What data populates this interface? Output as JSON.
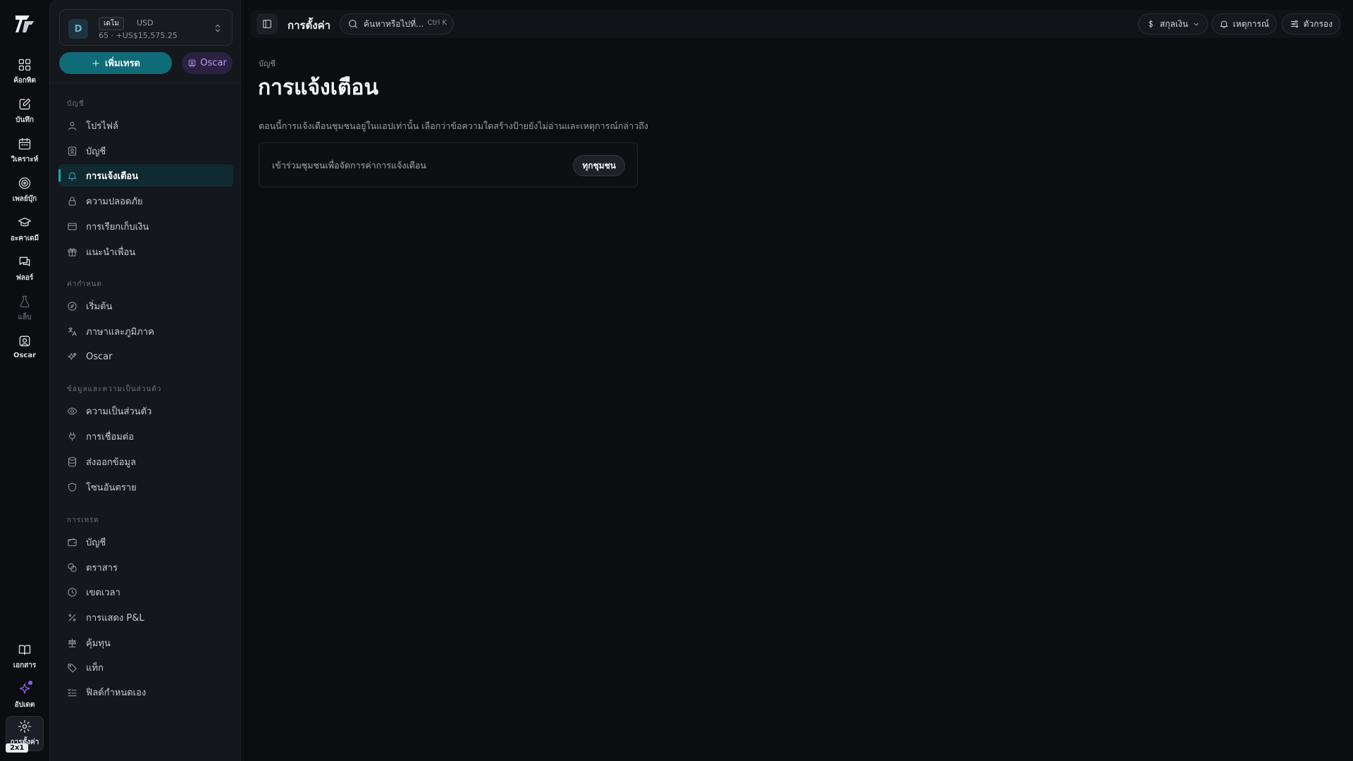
{
  "rail": {
    "items": [
      {
        "label": "ค้อกพิต",
        "icon": "dashboard-icon"
      },
      {
        "label": "บันทึก",
        "icon": "journal-icon"
      },
      {
        "label": "วิเคราะห์",
        "icon": "calendar-icon"
      },
      {
        "label": "เพลย์บุ๊ก",
        "icon": "target-icon"
      },
      {
        "label": "อะคาเดมี",
        "icon": "graduation-cap-icon"
      },
      {
        "label": "ฟลอร์",
        "icon": "chat-icon"
      },
      {
        "label": "แล็บ",
        "icon": "flask-icon"
      },
      {
        "label": "Oscar",
        "icon": "oscar-icon"
      }
    ],
    "bottom": [
      {
        "label": "เอกสาร",
        "icon": "book-icon"
      },
      {
        "label": "อัปเดต",
        "icon": "sparkle-icon"
      },
      {
        "label": "การตั้งค่า",
        "icon": "gear-icon"
      }
    ],
    "size_tag": "2x1"
  },
  "account": {
    "initial": "D",
    "badge": "เดโม",
    "currency": "USD",
    "subtitle": "65 · +US$15,575.25"
  },
  "buttons": {
    "add_trade": "เพิ่มเทรด",
    "oscar": "Oscar"
  },
  "sidebar": {
    "sections": [
      {
        "title": "บัญชี",
        "items": [
          {
            "label": "โปรไฟล์",
            "icon": "user-icon"
          },
          {
            "label": "บัญชี",
            "icon": "account-icon"
          },
          {
            "label": "การแจ้งเตือน",
            "icon": "bell-icon",
            "active": true
          },
          {
            "label": "ความปลอดภัย",
            "icon": "lock-icon"
          },
          {
            "label": "การเรียกเก็บเงิน",
            "icon": "credit-card-icon"
          },
          {
            "label": "แนะนำเพื่อน",
            "icon": "gift-icon"
          }
        ]
      },
      {
        "title": "ค่ากำหนด",
        "items": [
          {
            "label": "เริ่มต้น",
            "icon": "compass-icon"
          },
          {
            "label": "ภาษาและภูมิภาค",
            "icon": "translate-icon"
          },
          {
            "label": "Oscar",
            "icon": "sparkles-icon"
          }
        ]
      },
      {
        "title": "ข้อมูลและความเป็นส่วนตัว",
        "items": [
          {
            "label": "ความเป็นส่วนตัว",
            "icon": "eye-icon"
          },
          {
            "label": "การเชื่อมต่อ",
            "icon": "plug-icon"
          },
          {
            "label": "ส่งออกข้อมูล",
            "icon": "database-icon"
          },
          {
            "label": "โซนอันตราย",
            "icon": "shield-icon"
          }
        ]
      },
      {
        "title": "การเทรด",
        "items": [
          {
            "label": "บัญชี",
            "icon": "wallet-icon"
          },
          {
            "label": "ตราสาร",
            "icon": "coins-icon"
          },
          {
            "label": "เขตเวลา",
            "icon": "clock-icon"
          },
          {
            "label": "การแสดง P&L",
            "icon": "percent-icon"
          },
          {
            "label": "คุ้มทุน",
            "icon": "scale-icon"
          },
          {
            "label": "แท็ก",
            "icon": "tag-icon"
          },
          {
            "label": "ฟิลด์กำหนดเอง",
            "icon": "list-check-icon"
          }
        ]
      }
    ]
  },
  "topbar": {
    "title": "การตั้งค่า",
    "search_placeholder": "ค้นหาหรือไปที่...",
    "search_shortcut": "Ctrl K",
    "currency_label": "สกุลเงิน",
    "events_label": "เหตุการณ์",
    "filter_label": "ตัวกรอง"
  },
  "main": {
    "breadcrumb": "บัญชี",
    "title": "การแจ้งเตือน",
    "description": "ตอนนี้การแจ้งเตือนชุมชนอยู่ในแอปเท่านั้น เลือกว่าข้อความใดสร้างป้ายยังไม่อ่านและเหตุการณ์กล่าวถึง",
    "card_text": "เข้าร่วมชุมชนเพื่อจัดการค่าการแจ้งเตือน",
    "card_button": "ทุกชุมชน"
  },
  "colors": {
    "accent": "#0f6b78",
    "active_bg": "#102a32",
    "oscar_purple": "#b69cf5",
    "background": "#0b0d10"
  }
}
